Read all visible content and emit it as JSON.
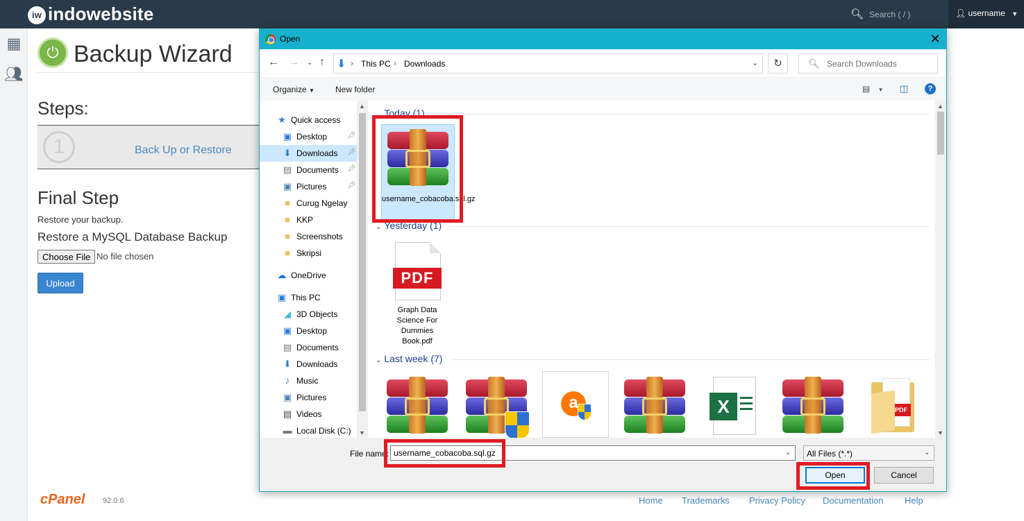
{
  "topbar": {
    "logo_text": "indowebsite",
    "logo_mark": "iw",
    "search_placeholder": "Search ( / )",
    "username": "username"
  },
  "page": {
    "title": "Backup Wizard",
    "steps_heading": "Steps:",
    "step_number": "1",
    "step_label": "Back Up or Restore",
    "final_heading": "Final Step",
    "final_subtitle": "Restore your backup.",
    "restore_heading": "Restore a MySQL Database Backup",
    "choose_file_label": "Choose File",
    "no_file_text": "No file chosen",
    "upload_label": "Upload"
  },
  "footer": {
    "brand": "cPanel",
    "version": "92.0.6",
    "links": [
      "Home",
      "Trademarks",
      "Privacy Policy",
      "Documentation",
      "Help"
    ]
  },
  "dialog": {
    "title": "Open",
    "close_glyph": "✕",
    "breadcrumb": [
      "This PC",
      "Downloads"
    ],
    "search_placeholder": "Search Downloads",
    "organize_label": "Organize",
    "new_folder_label": "New folder",
    "help_glyph": "?",
    "nav_items": [
      {
        "label": "Quick access",
        "icon": "star-icon",
        "pinned": false
      },
      {
        "label": "Desktop",
        "icon": "desktop-icon",
        "pinned": true
      },
      {
        "label": "Downloads",
        "icon": "download-icon",
        "pinned": true,
        "selected": true
      },
      {
        "label": "Documents",
        "icon": "documents-icon",
        "pinned": true
      },
      {
        "label": "Pictures",
        "icon": "pictures-icon",
        "pinned": true
      },
      {
        "label": "Curug Ngelay",
        "icon": "folder-icon",
        "pinned": false
      },
      {
        "label": "KKP",
        "icon": "folder-icon",
        "pinned": false
      },
      {
        "label": "Screenshots",
        "icon": "folder-icon",
        "pinned": false
      },
      {
        "label": "Skripsi",
        "icon": "folder-icon",
        "pinned": false
      },
      {
        "label": "OneDrive",
        "icon": "cloud-icon",
        "pinned": false
      },
      {
        "label": "This PC",
        "icon": "pc-icon",
        "pinned": false
      },
      {
        "label": "3D Objects",
        "icon": "cube-icon",
        "pinned": false
      },
      {
        "label": "Desktop",
        "icon": "desktop-icon",
        "pinned": false
      },
      {
        "label": "Documents",
        "icon": "documents-icon",
        "pinned": false
      },
      {
        "label": "Downloads",
        "icon": "download-icon",
        "pinned": false
      },
      {
        "label": "Music",
        "icon": "music-icon",
        "pinned": false
      },
      {
        "label": "Pictures",
        "icon": "pictures-icon",
        "pinned": false
      },
      {
        "label": "Videos",
        "icon": "videos-icon",
        "pinned": false
      },
      {
        "label": "Local Disk (C:)",
        "icon": "disk-icon",
        "pinned": false
      }
    ],
    "groups": {
      "today": "Today (1)",
      "yesterday": "Yesterday (1)",
      "last_week": "Last week (7)"
    },
    "files": {
      "today_file": "username_cobacoba.sql.gz",
      "yesterday_file": "Graph Data Science For Dummies Book.pdf"
    },
    "file_name_label": "File name:",
    "file_name_value": "username_cobacoba.sql.gz",
    "filter_value": "All Files (*.*)",
    "open_label": "Open",
    "cancel_label": "Cancel"
  },
  "colors": {
    "topbar_bg": "#293a4a",
    "dialog_accent": "#18b0cf",
    "highlight_red": "#e01b24",
    "link_blue": "#4a8ac0",
    "upload_blue": "#3a85d0",
    "cpanel_orange": "#e8651f"
  }
}
